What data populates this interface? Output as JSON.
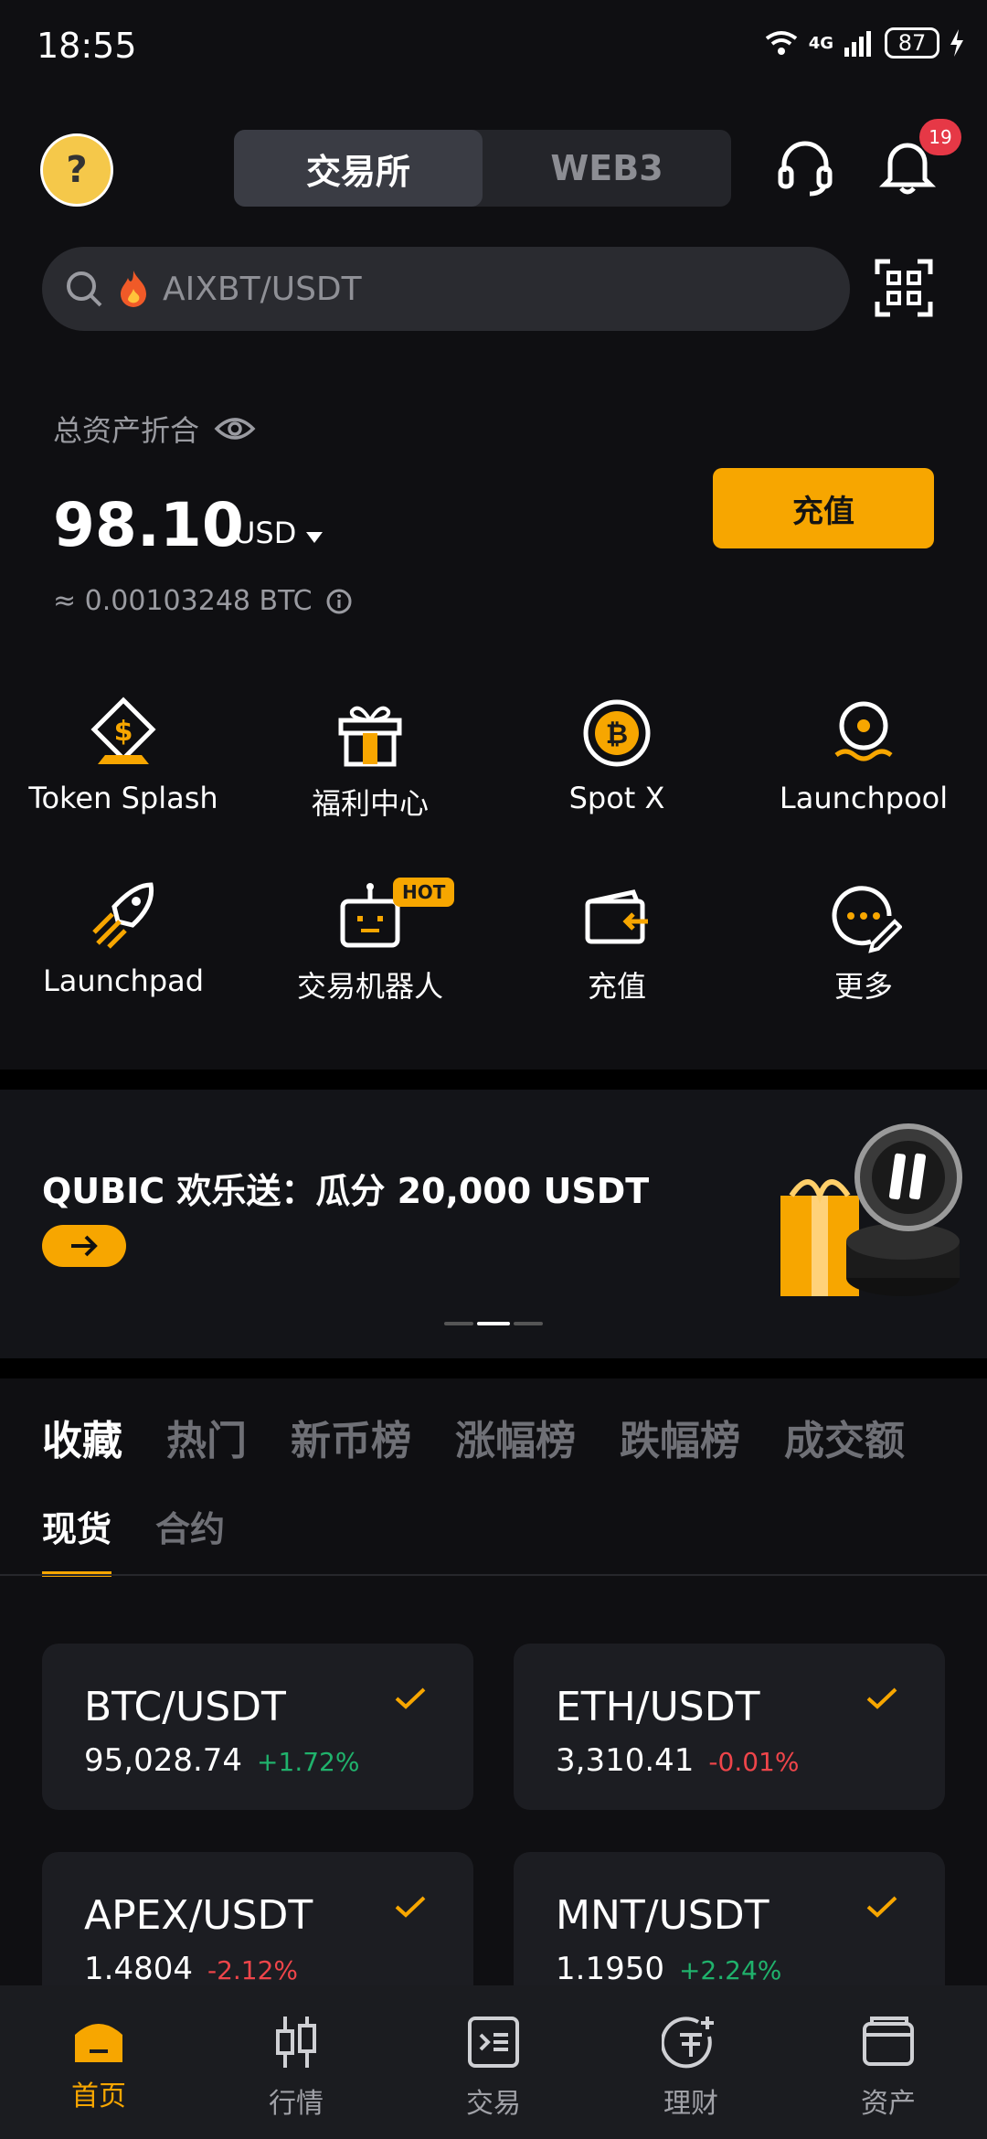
{
  "status": {
    "time": "18:55",
    "network": "4G",
    "battery": "87"
  },
  "header": {
    "avatar_symbol": "?",
    "tabs": [
      {
        "label": "交易所",
        "active": true
      },
      {
        "label": "WEB3",
        "active": false
      }
    ],
    "notification_count": "19"
  },
  "search": {
    "value": "AIXBT/USDT",
    "prefix_icon": "fire-icon"
  },
  "assets": {
    "label": "总资产折合",
    "value": "98.10",
    "currency": "USD",
    "btc_equiv": "≈ 0.00103248 BTC",
    "deposit_label": "充值"
  },
  "shortcuts": [
    {
      "label": "Token Splash",
      "icon": "token-splash-icon"
    },
    {
      "label": "福利中心",
      "icon": "gift-icon"
    },
    {
      "label": "Spot X",
      "icon": "bitcoin-icon"
    },
    {
      "label": "Launchpool",
      "icon": "launchpool-icon"
    },
    {
      "label": "Launchpad",
      "icon": "rocket-icon"
    },
    {
      "label": "交易机器人",
      "icon": "robot-icon",
      "tag": "HOT"
    },
    {
      "label": "充值",
      "icon": "wallet-deposit-icon"
    },
    {
      "label": "更多",
      "icon": "more-icon"
    }
  ],
  "banner": {
    "title": "QUBIC 欢乐送：瓜分 20,000 USDT"
  },
  "market_tabs": [
    {
      "label": "收藏",
      "active": true
    },
    {
      "label": "热门",
      "active": false
    },
    {
      "label": "新币榜",
      "active": false
    },
    {
      "label": "涨幅榜",
      "active": false
    },
    {
      "label": "跌幅榜",
      "active": false
    },
    {
      "label": "成交额",
      "active": false
    }
  ],
  "sub_tabs": [
    {
      "label": "现货",
      "active": true
    },
    {
      "label": "合约",
      "active": false
    }
  ],
  "cards": [
    {
      "pair": "BTC/USDT",
      "price": "95,028.74",
      "change": "+1.72%",
      "direction": "up"
    },
    {
      "pair": "ETH/USDT",
      "price": "3,310.41",
      "change": "-0.01%",
      "direction": "down"
    },
    {
      "pair": "APEX/USDT",
      "price": "1.4804",
      "change": "-2.12%",
      "direction": "down"
    },
    {
      "pair": "MNT/USDT",
      "price": "1.1950",
      "change": "+2.24%",
      "direction": "up"
    }
  ],
  "nav": [
    {
      "label": "首页",
      "active": true,
      "icon": "home-icon"
    },
    {
      "label": "行情",
      "active": false,
      "icon": "candlestick-icon"
    },
    {
      "label": "交易",
      "active": false,
      "icon": "trade-icon"
    },
    {
      "label": "理财",
      "active": false,
      "icon": "earn-icon"
    },
    {
      "label": "资产",
      "active": false,
      "icon": "assets-wallet-icon"
    }
  ],
  "colors": {
    "accent": "#f7a600",
    "up": "#20b26c",
    "down": "#ef454a",
    "background": "#0f0f12"
  }
}
